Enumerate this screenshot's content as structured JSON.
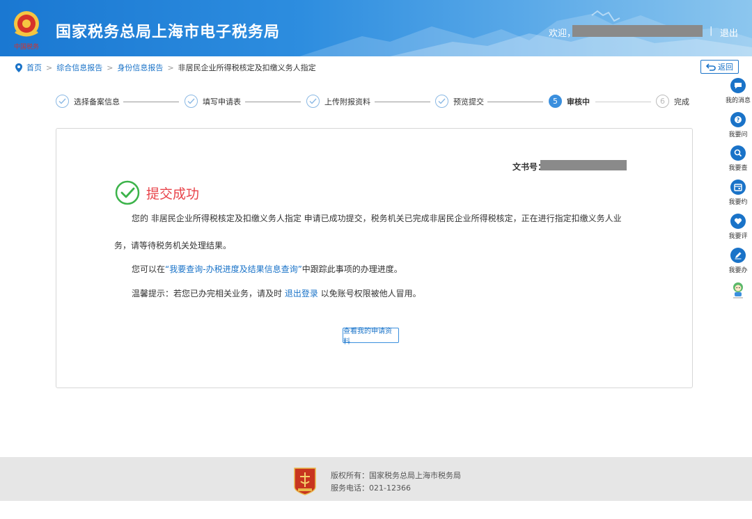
{
  "header": {
    "title": "国家税务总局上海市电子税务局",
    "welcome": "欢迎，",
    "separator": "|",
    "logout": "退出",
    "logo_text": "中国税务"
  },
  "breadcrumb": {
    "home": "首页",
    "level1": "综合信息报告",
    "level2": "身份信息报告",
    "current": "非居民企业所得税核定及扣缴义务人指定",
    "sep": ">"
  },
  "back_button": "返回",
  "steps": [
    {
      "label": "选择备案信息",
      "state": "done"
    },
    {
      "label": "填写申请表",
      "state": "done"
    },
    {
      "label": "上传附报资料",
      "state": "done"
    },
    {
      "label": "预览提交",
      "state": "done"
    },
    {
      "label": "审核中",
      "state": "active",
      "number": "5"
    },
    {
      "label": "完成",
      "state": "todo",
      "number": "6"
    }
  ],
  "content": {
    "doc_no_label": "文书号：",
    "success_title": "提交成功",
    "para1": "您的 非居民企业所得税核定及扣缴义务人指定 申请已成功提交，税务机关已完成非居民企业所得税核定，正在进行指定扣缴义务人业",
    "para2": "务，请等待税务机关处理结果。",
    "para3_pre": "您可以在",
    "para3_link": "“我要查询-办税进度及结果信息查询”",
    "para3_post": "中跟踪此事项的办理进度。",
    "para4_pre": "温馨提示：若您已办完相关业务，请及时 ",
    "para4_link": "退出登录",
    "para4_post": " 以免账号权限被他人冒用。",
    "view_button": "查看我的申请资料"
  },
  "sidebar": [
    {
      "label": "我的消息",
      "icon": "message-icon"
    },
    {
      "label": "我要问",
      "icon": "question-icon"
    },
    {
      "label": "我要查",
      "icon": "search-icon"
    },
    {
      "label": "我要约",
      "icon": "calendar-icon"
    },
    {
      "label": "我要评",
      "icon": "heart-icon"
    },
    {
      "label": "我要办",
      "icon": "pen-icon"
    }
  ],
  "footer": {
    "copyright": "版权所有：国家税务总局上海市税务局",
    "phone": "服务电话：021-12366"
  },
  "colors": {
    "primary": "#1a73c8",
    "success": "#3cb34a",
    "success_title": "#e8434a",
    "footer_bg": "#e6e6e6"
  }
}
